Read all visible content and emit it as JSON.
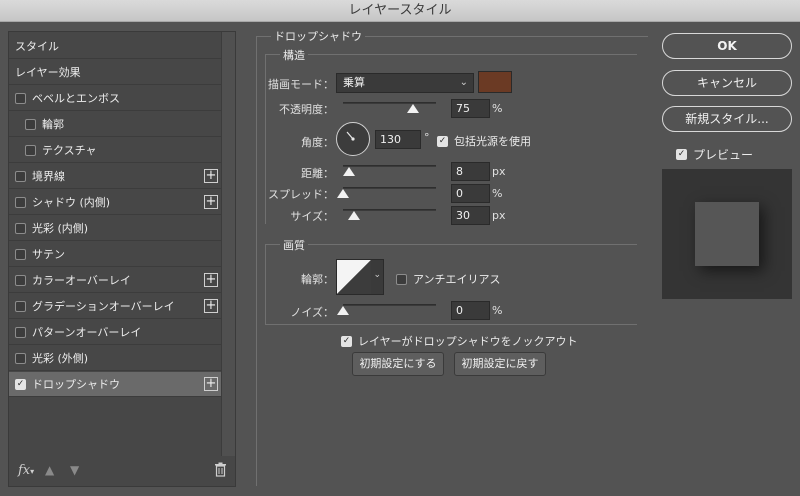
{
  "window": {
    "title": "レイヤースタイル"
  },
  "sidebar": {
    "items": [
      {
        "label": "スタイル",
        "checkbox": false,
        "checked": false,
        "plus": false,
        "selected": false,
        "indent": 0
      },
      {
        "label": "レイヤー効果",
        "checkbox": false,
        "checked": false,
        "plus": false,
        "selected": false,
        "indent": 0
      },
      {
        "label": "ベベルとエンボス",
        "checkbox": true,
        "checked": false,
        "plus": false,
        "selected": false,
        "indent": 0
      },
      {
        "label": "輪郭",
        "checkbox": true,
        "checked": false,
        "plus": false,
        "selected": false,
        "indent": 1
      },
      {
        "label": "テクスチャ",
        "checkbox": true,
        "checked": false,
        "plus": false,
        "selected": false,
        "indent": 1
      },
      {
        "label": "境界線",
        "checkbox": true,
        "checked": false,
        "plus": true,
        "selected": false,
        "indent": 0
      },
      {
        "label": "シャドウ (内側)",
        "checkbox": true,
        "checked": false,
        "plus": true,
        "selected": false,
        "indent": 0
      },
      {
        "label": "光彩 (内側)",
        "checkbox": true,
        "checked": false,
        "plus": false,
        "selected": false,
        "indent": 0
      },
      {
        "label": "サテン",
        "checkbox": true,
        "checked": false,
        "plus": false,
        "selected": false,
        "indent": 0
      },
      {
        "label": "カラーオーバーレイ",
        "checkbox": true,
        "checked": false,
        "plus": true,
        "selected": false,
        "indent": 0
      },
      {
        "label": "グラデーションオーバーレイ",
        "checkbox": true,
        "checked": false,
        "plus": true,
        "selected": false,
        "indent": 0
      },
      {
        "label": "パターンオーバーレイ",
        "checkbox": true,
        "checked": false,
        "plus": false,
        "selected": false,
        "indent": 0
      },
      {
        "label": "光彩 (外側)",
        "checkbox": true,
        "checked": false,
        "plus": false,
        "selected": false,
        "indent": 0
      },
      {
        "label": "ドロップシャドウ",
        "checkbox": true,
        "checked": true,
        "plus": true,
        "selected": true,
        "indent": 0
      }
    ],
    "footer": {
      "fx_label": "fx",
      "icons": [
        "fx-menu-icon",
        "move-up-icon",
        "move-down-icon",
        "trash-icon"
      ]
    }
  },
  "panel": {
    "title": "ドロップシャドウ",
    "structure": {
      "heading": "構造",
      "blend_mode_label": "描画モード：",
      "blend_mode_value": "乗算",
      "shadow_color": "#6b3a24",
      "opacity_label": "不透明度：",
      "opacity_value": "75",
      "opacity_unit": "%",
      "opacity_level": 0.75,
      "angle_label": "角度：",
      "angle_value": "130",
      "angle_unit": "°",
      "global_light_label": "包括光源を使用",
      "global_light_checked": true,
      "distance_label": "距離：",
      "distance_value": "8",
      "distance_unit": "px",
      "distance_level": 0.06,
      "spread_label": "スプレッド：",
      "spread_value": "0",
      "spread_unit": "%",
      "spread_level": 0.0,
      "size_label": "サイズ：",
      "size_value": "30",
      "size_unit": "px",
      "size_level": 0.12
    },
    "quality": {
      "heading": "画質",
      "contour_label": "輪郭：",
      "antialias_label": "アンチエイリアス",
      "antialias_checked": false,
      "noise_label": "ノイズ：",
      "noise_value": "0",
      "noise_unit": "%",
      "noise_level": 0.0
    },
    "knockout_label": "レイヤーがドロップシャドウをノックアウト",
    "knockout_checked": true,
    "make_default_label": "初期設定にする",
    "reset_default_label": "初期設定に戻す"
  },
  "actions": {
    "ok_label": "OK",
    "cancel_label": "キャンセル",
    "new_style_label": "新規スタイル...",
    "preview_label": "プレビュー",
    "preview_checked": true
  },
  "colors": {
    "background": "#535353",
    "list_bg": "#474747",
    "selected_row": "#6a6a6a",
    "swatch": "#6b3a24"
  }
}
